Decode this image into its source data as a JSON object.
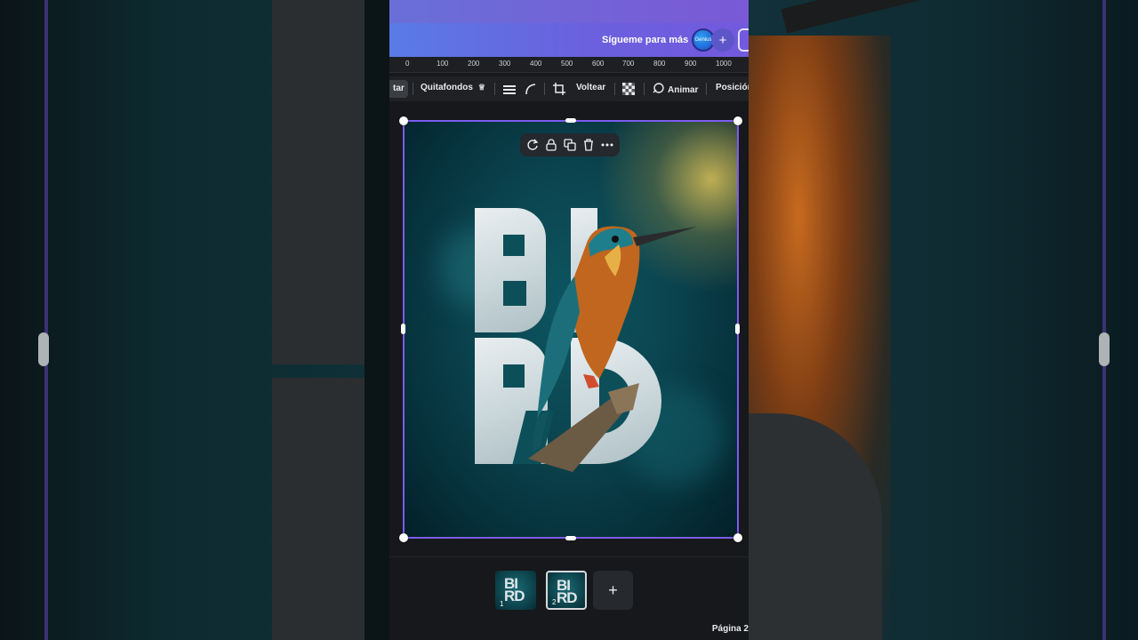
{
  "header": {
    "follow_text": "Sígueme para más",
    "badge_text": "Genius",
    "plus": "+"
  },
  "ruler": {
    "ticks": [
      "0",
      "100",
      "200",
      "300",
      "400",
      "500",
      "600",
      "700",
      "800",
      "900",
      "1000"
    ]
  },
  "toolbar": {
    "edit_label": "tar",
    "remove_bg_label": "Quitafondos",
    "remove_bg_icon": "crown-icon",
    "flip_label": "Voltear",
    "animate_label": "Animar",
    "position_label": "Posición"
  },
  "design": {
    "word": "BIRD"
  },
  "float_toolbar": {
    "items": [
      "rotate-comment-icon",
      "lock-icon",
      "duplicate-icon",
      "trash-icon",
      "more-icon"
    ]
  },
  "pages": {
    "thumbs": [
      {
        "number": "1",
        "mini_text": "BI RD"
      },
      {
        "number": "2",
        "mini_text": "BI RD"
      }
    ],
    "add_label": "+",
    "current_page_label": "Página 2"
  },
  "colors": {
    "accent": "#7c5cf0",
    "topbar_start": "#5a7be6",
    "topbar_end": "#7259de",
    "canvas_bg": "#0d5661"
  }
}
